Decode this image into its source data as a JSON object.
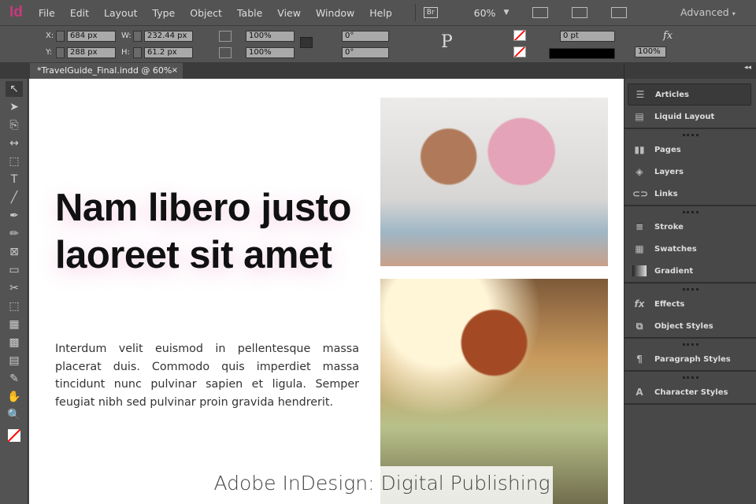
{
  "app": {
    "logo": "Id",
    "menu": [
      "File",
      "Edit",
      "Layout",
      "Type",
      "Object",
      "Table",
      "View",
      "Window",
      "Help"
    ],
    "bridge": "Br",
    "zoom": "60%",
    "workspace": "Advanced"
  },
  "control": {
    "x_label": "X:",
    "x": "684 px",
    "y_label": "Y:",
    "y": "288 px",
    "w_label": "W:",
    "w": "232.44 px",
    "h_label": "H:",
    "h": "61.2 px",
    "scale_x": "100%",
    "scale_y": "100%",
    "rotate": "0°",
    "shear": "0°",
    "stroke_weight": "0 pt",
    "opacity": "100%",
    "p_icon": "P"
  },
  "tab": {
    "title": "*TravelGuide_Final.indd @ 60%",
    "close": "×"
  },
  "tools": [
    "↖",
    "➤",
    "⎘",
    "↔",
    "⬚",
    "T",
    "╱",
    "✒",
    "✏",
    "⊠",
    "▭",
    "✂",
    "⬚",
    "▦",
    "▩",
    "▤",
    "✎",
    "✋",
    "🔍"
  ],
  "document": {
    "headline_1": "Nam libero justo",
    "headline_2": "laoreet sit amet",
    "body": "Interdum velit euismod in pellentesque massa placerat duis. Commodo quis imperdiet massa tincidunt nunc pulvinar sapien et ligula. Semper feugiat nibh sed pulvinar proin gravida hendrerit.",
    "caption": "Adobe InDesign: Digital Publishing"
  },
  "panel": {
    "groups": [
      [
        "Articles",
        "Liquid Layout"
      ],
      [
        "Pages",
        "Layers",
        "Links"
      ],
      [
        "Stroke",
        "Swatches",
        "Gradient"
      ],
      [
        "Effects",
        "Object Styles"
      ],
      [
        "Paragraph Styles"
      ],
      [
        "Character Styles"
      ]
    ],
    "collapse": "◂◂"
  },
  "colors": {
    "accent": "#c8397c",
    "panel_bg": "#484848",
    "ui_bg": "#535353"
  }
}
